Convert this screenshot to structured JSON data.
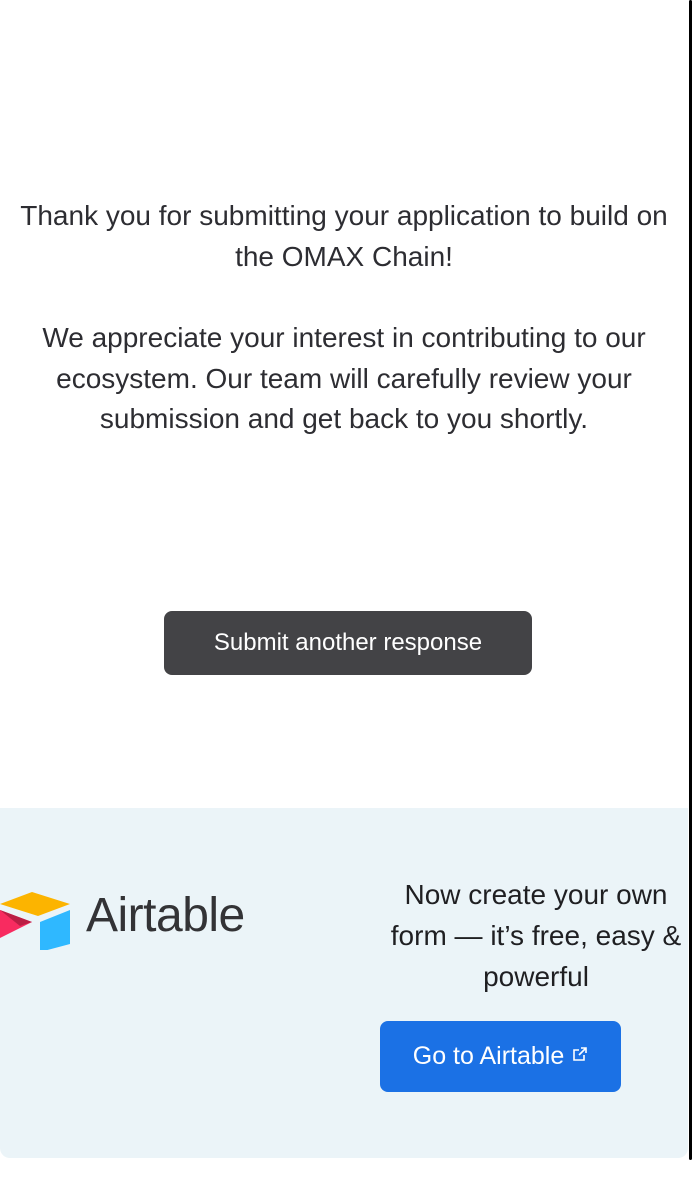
{
  "confirmation": {
    "line1": "Thank you for submitting your application to build on the OMAX Chain!",
    "line2": "We appreciate your interest in contributing to our ecosystem. Our team will carefully review your submission and get back to you shortly."
  },
  "submit_another_label": "Submit another response",
  "footer": {
    "logo_text": "Airtable",
    "promo_text": "Now create your own form — it’s free, easy & powerful",
    "go_button_label": "Go to Airtable"
  },
  "icons": {
    "logo": "airtable-logo-icon",
    "external_link": "external-link-icon"
  },
  "colors": {
    "submit_button": "#434346",
    "go_button": "#1b71e5",
    "footer_background": "#ebf4f8",
    "logo_yellow": "#fcb400",
    "logo_blue": "#2fb8ff",
    "logo_red": "#f82b60"
  }
}
